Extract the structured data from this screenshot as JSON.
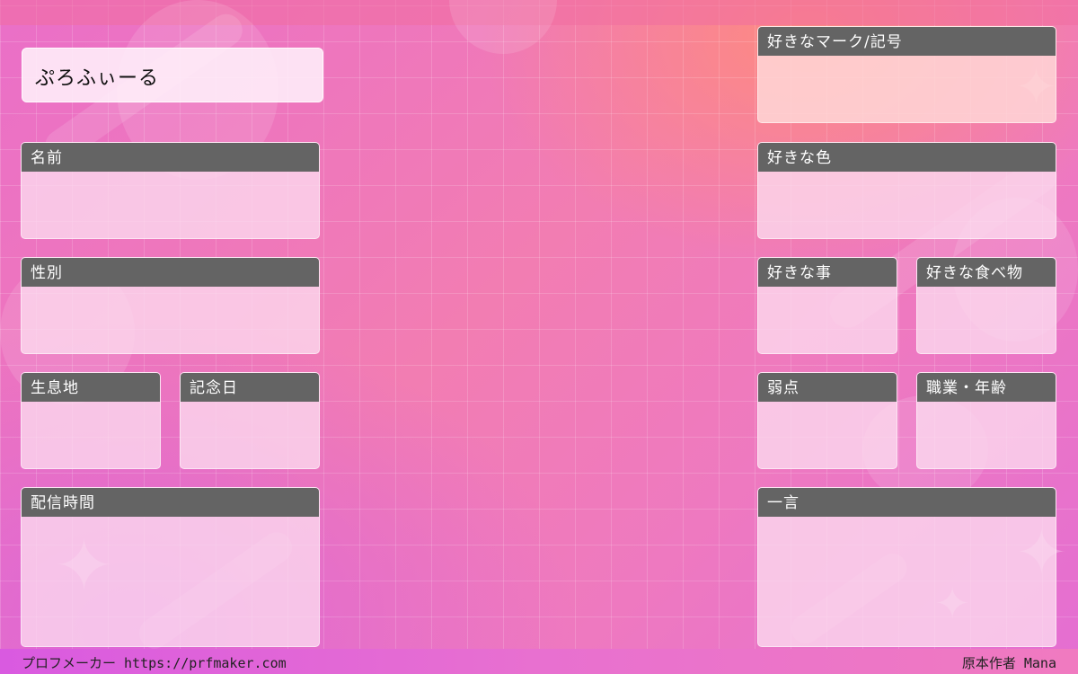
{
  "title": "ぷろふぃーる",
  "left_panels": {
    "name": "名前",
    "gender": "性別",
    "habitat": "生息地",
    "anniversary": "記念日",
    "stream_time": "配信時間"
  },
  "right_panels": {
    "favorite_mark": "好きなマーク/記号",
    "favorite_color": "好きな色",
    "favorite_thing": "好きな事",
    "favorite_food": "好きな食べ物",
    "weakness": "弱点",
    "job_age": "職業・年齢",
    "one_word": "一言"
  },
  "footer": {
    "site": "プロフメーカー https://prfmaker.com",
    "author": "原本作者 Mana"
  },
  "colors": {
    "header": "#646464",
    "panel_fill": "#fcdcf0",
    "background_accent": "#f27db2"
  },
  "icons": [
    "sparkle-icon"
  ]
}
